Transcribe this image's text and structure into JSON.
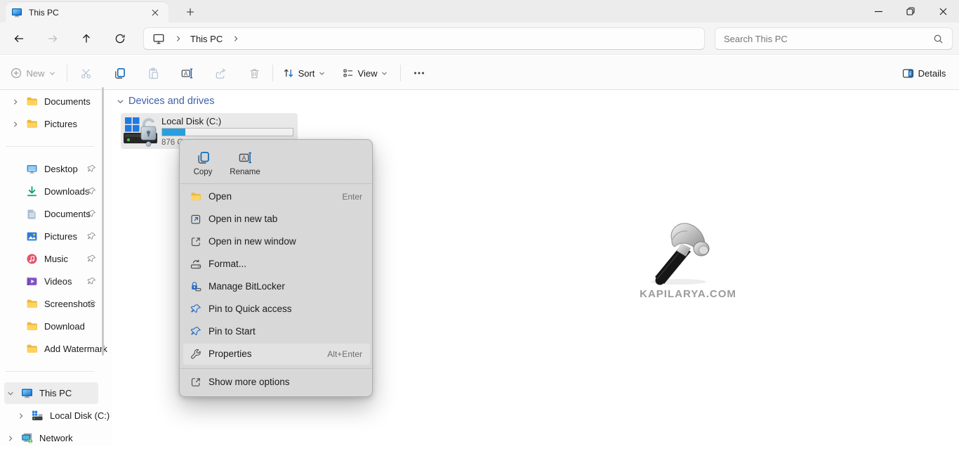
{
  "titlebar": {
    "tab_title": "This PC"
  },
  "navbar": {
    "breadcrumb_label": "This PC",
    "search_placeholder": "Search This PC"
  },
  "toolbar": {
    "new_label": "New",
    "sort_label": "Sort",
    "view_label": "View",
    "details_label": "Details"
  },
  "sidebar": {
    "items": [
      {
        "label": "Documents"
      },
      {
        "label": "Pictures"
      },
      {
        "label": "Desktop",
        "pinned": true
      },
      {
        "label": "Downloads",
        "pinned": true
      },
      {
        "label": "Documents",
        "pinned": true
      },
      {
        "label": "Pictures",
        "pinned": true
      },
      {
        "label": "Music",
        "pinned": true
      },
      {
        "label": "Videos",
        "pinned": true
      },
      {
        "label": "Screenshots",
        "pinned": true
      },
      {
        "label": "Download"
      },
      {
        "label": "Add Watermark"
      },
      {
        "label": "This PC",
        "selected": true
      },
      {
        "label": "Local Disk (C:)"
      },
      {
        "label": "Network"
      }
    ]
  },
  "main": {
    "group_header": "Devices and drives",
    "drive": {
      "name": "Local Disk (C:)",
      "free_label": "876 G",
      "usage_percent": 18
    }
  },
  "context_menu": {
    "quick_actions": [
      {
        "label": "Copy"
      },
      {
        "label": "Rename"
      }
    ],
    "items": [
      {
        "label": "Open",
        "shortcut": "Enter"
      },
      {
        "label": "Open in new tab"
      },
      {
        "label": "Open in new window"
      },
      {
        "label": "Format..."
      },
      {
        "label": "Manage BitLocker"
      },
      {
        "label": "Pin to Quick access"
      },
      {
        "label": "Pin to Start"
      },
      {
        "label": "Properties",
        "shortcut": "Alt+Enter",
        "highlighted": true
      },
      {
        "label": "Show more options"
      }
    ]
  },
  "watermark": {
    "text": "KAPILARYA.COM"
  },
  "colors": {
    "accent_blue": "#0f6cbd",
    "progress_blue": "#29a0dd",
    "group_header_blue": "#3f60a8",
    "menu_bg": "#d8d8d8"
  }
}
